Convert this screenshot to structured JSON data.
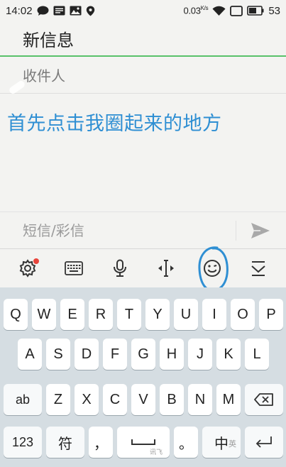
{
  "status_bar": {
    "time": "14:02",
    "network_speed": "0.03",
    "network_unit": "K/s",
    "battery": "53",
    "icons": [
      "chat-bubble-icon",
      "message-icon",
      "image-icon",
      "location-icon",
      "wifi-icon",
      "sim-icon",
      "battery-icon"
    ]
  },
  "header": {
    "title": "新信息"
  },
  "recipient": {
    "placeholder": "收件人"
  },
  "annotation": {
    "text": "首先点击我圈起来的地方"
  },
  "compose": {
    "placeholder": "短信/彩信"
  },
  "keyboard_toolbar": {
    "items": [
      "settings-icon",
      "keyboard-icon",
      "microphone-icon",
      "cursor-icon",
      "emoji-icon",
      "hide-keyboard-icon"
    ],
    "accent_dot_color": "#e8453c",
    "circle_color": "#2f8fd3"
  },
  "keyboard": {
    "row1": [
      "Q",
      "W",
      "E",
      "R",
      "T",
      "Y",
      "U",
      "I",
      "O",
      "P"
    ],
    "row2": [
      "A",
      "S",
      "D",
      "F",
      "G",
      "H",
      "J",
      "K",
      "L"
    ],
    "row3": [
      "Z",
      "X",
      "C",
      "V",
      "B",
      "N",
      "M"
    ],
    "shift_label": "ab",
    "num_label": "123",
    "symbol_label": "符",
    "comma_label": "，",
    "space_sub_label": "讯飞",
    "period_label": "。",
    "lang_label": "中",
    "lang_sub_label": "英"
  },
  "colors": {
    "accent_green": "#59c16a",
    "annotation_blue": "#2f8fd3"
  }
}
